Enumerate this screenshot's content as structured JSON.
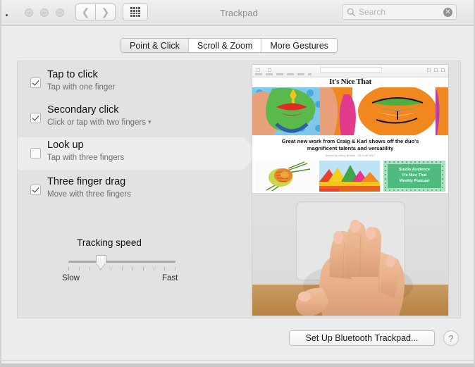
{
  "window": {
    "title": "Trackpad",
    "traffic_lights": [
      "close",
      "minimize",
      "zoom"
    ],
    "nav_back_icon": "chevron-left-icon",
    "nav_forward_icon": "chevron-right-icon",
    "grid_icon": "show-all-grid-icon"
  },
  "search": {
    "placeholder": "Search",
    "icon": "search-icon",
    "clear_icon": "clear-circle-icon",
    "clear_glyph": "✕"
  },
  "tabs": [
    {
      "label": "Point & Click",
      "selected": true
    },
    {
      "label": "Scroll & Zoom",
      "selected": false
    },
    {
      "label": "More Gestures",
      "selected": false
    }
  ],
  "options": [
    {
      "title": "Tap to click",
      "subtitle": "Tap with one finger",
      "checked": true,
      "highlighted": false,
      "has_dropdown": false
    },
    {
      "title": "Secondary click",
      "subtitle": "Click or tap with two fingers",
      "checked": true,
      "highlighted": false,
      "has_dropdown": true,
      "dropdown_icon": "chevron-down-icon",
      "dropdown_glyph": "▾"
    },
    {
      "title": "Look up",
      "subtitle": "Tap with three fingers",
      "checked": false,
      "highlighted": true,
      "has_dropdown": false
    },
    {
      "title": "Three finger drag",
      "subtitle": "Move with three fingers",
      "checked": true,
      "highlighted": false,
      "has_dropdown": false
    }
  ],
  "slider": {
    "label": "Tracking speed",
    "min_label": "Slow",
    "max_label": "Fast",
    "tick_count": 11,
    "value_index": 3,
    "value_percent": 34
  },
  "preview": {
    "site_title": "It's Nice That",
    "headline": "Great new work from Craig & Karl shows off the duo's magnificent talents and versatility",
    "byline": "Words by Jenny Brewer · 29 June 2017",
    "podcast_card": "Studio Audience\nIt's Nice That\nWeekly Podcast",
    "podcast_lines": [
      "Studio Audience",
      "It's Nice That",
      "Weekly Podcast"
    ],
    "bottom_image_alt": "hand with three fingers resting on a trackpad"
  },
  "footer": {
    "bluetooth_button": "Set Up Bluetooth Trackpad...",
    "help_button": "?",
    "help_icon": "question-mark-icon"
  },
  "colors": {
    "window_bg": "#ececec",
    "panel_bg": "#e2e2e2",
    "highlight_row": "#ededed",
    "title_text": "#8d8d8d",
    "subtitle_text": "#6e6e6e",
    "podcast_green": "#4fbb7e",
    "help_blue": "#6f8fb8"
  }
}
